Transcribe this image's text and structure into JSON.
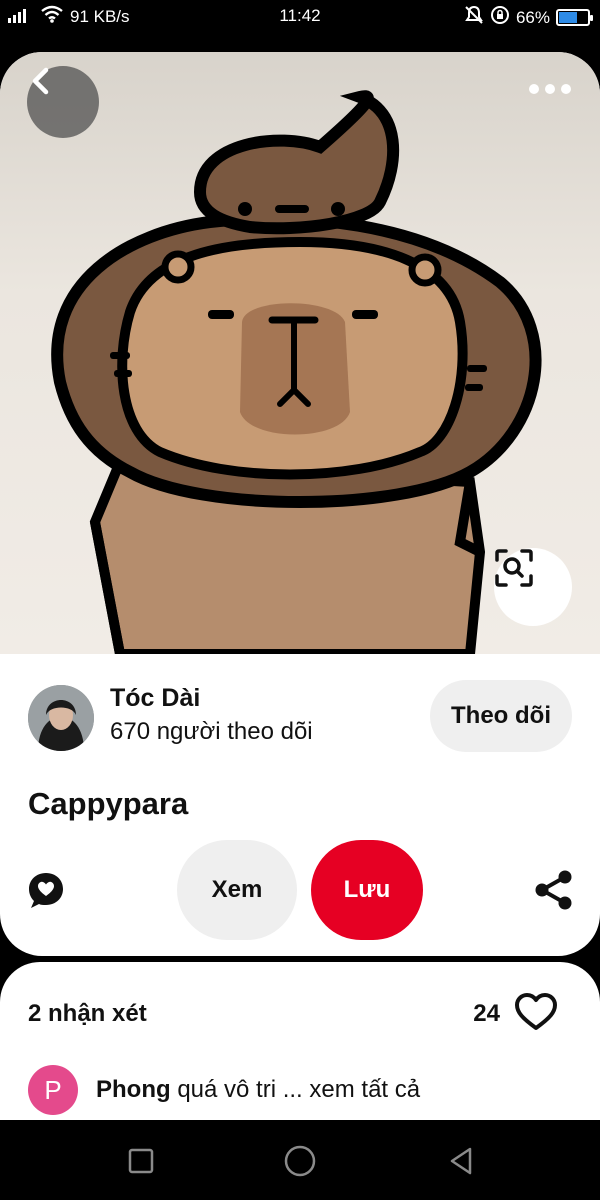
{
  "status_bar": {
    "network": "4G",
    "speed": "91 KB/s",
    "time": "11:42",
    "battery": "66%",
    "battery_level": 0.66,
    "icons": [
      "signal-icon",
      "wifi-icon",
      "mute-icon",
      "rotation-lock-icon",
      "battery-icon"
    ]
  },
  "pin": {
    "image_subject": "capybara-cartoon",
    "title": "Cappypara",
    "icons": {
      "back": "chevron-left-icon",
      "more": "more-dots-icon",
      "lens": "visual-search-icon"
    }
  },
  "author": {
    "name": "Tóc Dài",
    "followers": "670 người theo dõi",
    "follow_label": "Theo dõi"
  },
  "actions": {
    "view_label": "Xem",
    "save_label": "Lưu",
    "save_color": "#e60023",
    "comment_icon": "comment-heart-icon",
    "share_icon": "share-icon"
  },
  "comments": {
    "count_label": "2 nhận xét",
    "likes": "24",
    "items": [
      {
        "initial": "P",
        "author": "Phong",
        "text": "quá vô tri ... xem tất cả"
      }
    ]
  },
  "nav": {
    "icons": [
      "recent-apps-icon",
      "home-icon",
      "back-icon"
    ]
  }
}
